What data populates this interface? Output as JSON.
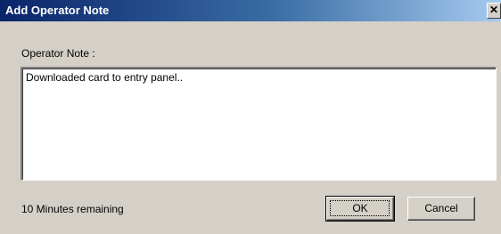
{
  "window": {
    "title": "Add Operator Note",
    "close_glyph": "✕",
    "close_icon": "close-icon"
  },
  "note": {
    "label": "Operator Note :",
    "value": "Downloaded card to entry panel.."
  },
  "status": {
    "remaining": "10 Minutes remaining"
  },
  "buttons": {
    "ok": "OK",
    "cancel": "Cancel"
  },
  "colors": {
    "titlebar_start": "#0a246a",
    "titlebar_end": "#a6caf0",
    "dialog_bg": "#d4d0c8"
  }
}
